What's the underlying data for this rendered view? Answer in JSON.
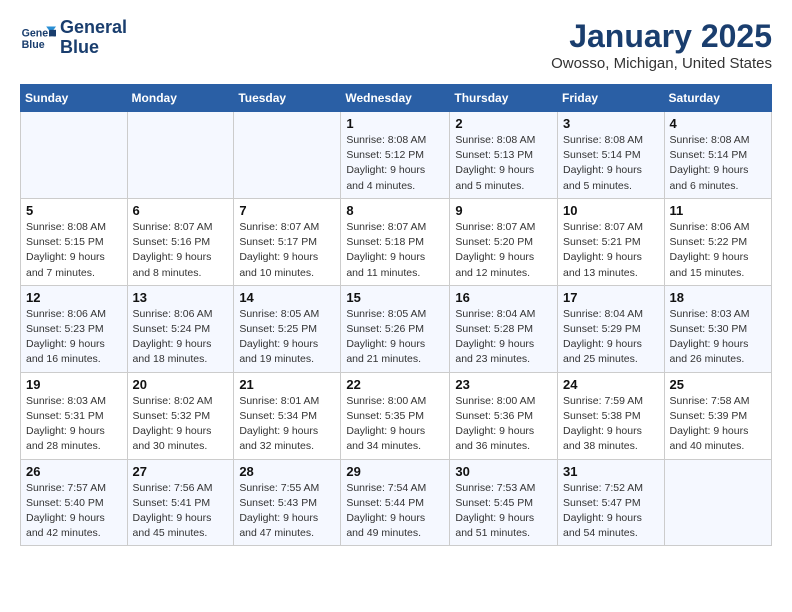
{
  "logo": {
    "line1": "General",
    "line2": "Blue"
  },
  "title": "January 2025",
  "subtitle": "Owosso, Michigan, United States",
  "weekdays": [
    "Sunday",
    "Monday",
    "Tuesday",
    "Wednesday",
    "Thursday",
    "Friday",
    "Saturday"
  ],
  "weeks": [
    [
      {
        "day": "",
        "info": ""
      },
      {
        "day": "",
        "info": ""
      },
      {
        "day": "",
        "info": ""
      },
      {
        "day": "1",
        "info": "Sunrise: 8:08 AM\nSunset: 5:12 PM\nDaylight: 9 hours\nand 4 minutes."
      },
      {
        "day": "2",
        "info": "Sunrise: 8:08 AM\nSunset: 5:13 PM\nDaylight: 9 hours\nand 5 minutes."
      },
      {
        "day": "3",
        "info": "Sunrise: 8:08 AM\nSunset: 5:14 PM\nDaylight: 9 hours\nand 5 minutes."
      },
      {
        "day": "4",
        "info": "Sunrise: 8:08 AM\nSunset: 5:14 PM\nDaylight: 9 hours\nand 6 minutes."
      }
    ],
    [
      {
        "day": "5",
        "info": "Sunrise: 8:08 AM\nSunset: 5:15 PM\nDaylight: 9 hours\nand 7 minutes."
      },
      {
        "day": "6",
        "info": "Sunrise: 8:07 AM\nSunset: 5:16 PM\nDaylight: 9 hours\nand 8 minutes."
      },
      {
        "day": "7",
        "info": "Sunrise: 8:07 AM\nSunset: 5:17 PM\nDaylight: 9 hours\nand 10 minutes."
      },
      {
        "day": "8",
        "info": "Sunrise: 8:07 AM\nSunset: 5:18 PM\nDaylight: 9 hours\nand 11 minutes."
      },
      {
        "day": "9",
        "info": "Sunrise: 8:07 AM\nSunset: 5:20 PM\nDaylight: 9 hours\nand 12 minutes."
      },
      {
        "day": "10",
        "info": "Sunrise: 8:07 AM\nSunset: 5:21 PM\nDaylight: 9 hours\nand 13 minutes."
      },
      {
        "day": "11",
        "info": "Sunrise: 8:06 AM\nSunset: 5:22 PM\nDaylight: 9 hours\nand 15 minutes."
      }
    ],
    [
      {
        "day": "12",
        "info": "Sunrise: 8:06 AM\nSunset: 5:23 PM\nDaylight: 9 hours\nand 16 minutes."
      },
      {
        "day": "13",
        "info": "Sunrise: 8:06 AM\nSunset: 5:24 PM\nDaylight: 9 hours\nand 18 minutes."
      },
      {
        "day": "14",
        "info": "Sunrise: 8:05 AM\nSunset: 5:25 PM\nDaylight: 9 hours\nand 19 minutes."
      },
      {
        "day": "15",
        "info": "Sunrise: 8:05 AM\nSunset: 5:26 PM\nDaylight: 9 hours\nand 21 minutes."
      },
      {
        "day": "16",
        "info": "Sunrise: 8:04 AM\nSunset: 5:28 PM\nDaylight: 9 hours\nand 23 minutes."
      },
      {
        "day": "17",
        "info": "Sunrise: 8:04 AM\nSunset: 5:29 PM\nDaylight: 9 hours\nand 25 minutes."
      },
      {
        "day": "18",
        "info": "Sunrise: 8:03 AM\nSunset: 5:30 PM\nDaylight: 9 hours\nand 26 minutes."
      }
    ],
    [
      {
        "day": "19",
        "info": "Sunrise: 8:03 AM\nSunset: 5:31 PM\nDaylight: 9 hours\nand 28 minutes."
      },
      {
        "day": "20",
        "info": "Sunrise: 8:02 AM\nSunset: 5:32 PM\nDaylight: 9 hours\nand 30 minutes."
      },
      {
        "day": "21",
        "info": "Sunrise: 8:01 AM\nSunset: 5:34 PM\nDaylight: 9 hours\nand 32 minutes."
      },
      {
        "day": "22",
        "info": "Sunrise: 8:00 AM\nSunset: 5:35 PM\nDaylight: 9 hours\nand 34 minutes."
      },
      {
        "day": "23",
        "info": "Sunrise: 8:00 AM\nSunset: 5:36 PM\nDaylight: 9 hours\nand 36 minutes."
      },
      {
        "day": "24",
        "info": "Sunrise: 7:59 AM\nSunset: 5:38 PM\nDaylight: 9 hours\nand 38 minutes."
      },
      {
        "day": "25",
        "info": "Sunrise: 7:58 AM\nSunset: 5:39 PM\nDaylight: 9 hours\nand 40 minutes."
      }
    ],
    [
      {
        "day": "26",
        "info": "Sunrise: 7:57 AM\nSunset: 5:40 PM\nDaylight: 9 hours\nand 42 minutes."
      },
      {
        "day": "27",
        "info": "Sunrise: 7:56 AM\nSunset: 5:41 PM\nDaylight: 9 hours\nand 45 minutes."
      },
      {
        "day": "28",
        "info": "Sunrise: 7:55 AM\nSunset: 5:43 PM\nDaylight: 9 hours\nand 47 minutes."
      },
      {
        "day": "29",
        "info": "Sunrise: 7:54 AM\nSunset: 5:44 PM\nDaylight: 9 hours\nand 49 minutes."
      },
      {
        "day": "30",
        "info": "Sunrise: 7:53 AM\nSunset: 5:45 PM\nDaylight: 9 hours\nand 51 minutes."
      },
      {
        "day": "31",
        "info": "Sunrise: 7:52 AM\nSunset: 5:47 PM\nDaylight: 9 hours\nand 54 minutes."
      },
      {
        "day": "",
        "info": ""
      }
    ]
  ]
}
